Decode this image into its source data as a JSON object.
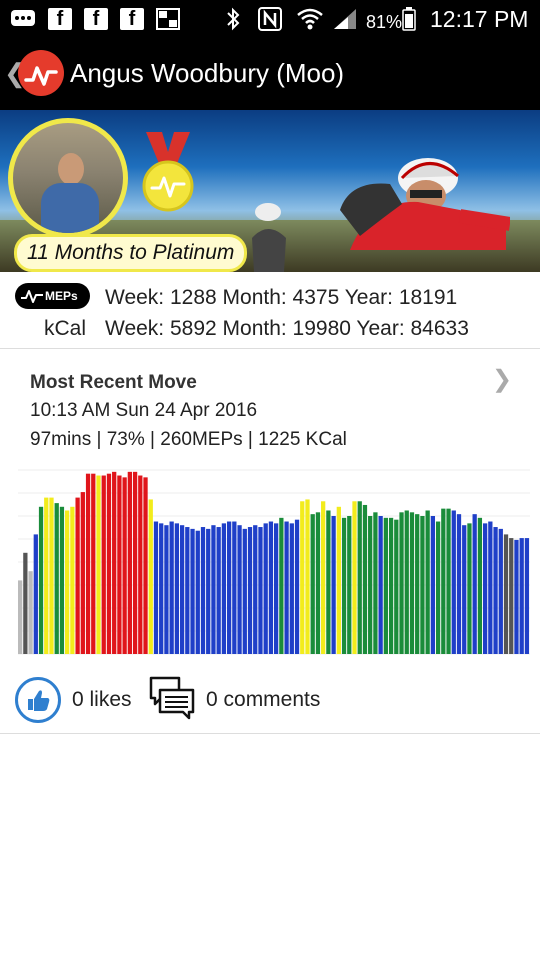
{
  "status_bar": {
    "notification_icons": [
      "message-icon",
      "facebook-icon",
      "facebook-icon",
      "facebook-icon",
      "gallery-icon"
    ],
    "system_icons": [
      "bluetooth-icon",
      "nfc-icon",
      "wifi-icon",
      "signal-icon"
    ],
    "battery": "81%",
    "time": "12:17 PM"
  },
  "app_bar": {
    "title": "Angus Woodbury (Moo)",
    "brand_color": "#e53b2c"
  },
  "banner": {
    "platinum_text": "11 Months to Platinum",
    "medal_color": "#f0e84a",
    "ribbon_color": "#d8322b"
  },
  "stats": {
    "meps_badge": "MEPs",
    "meps": "Week: 1288 Month: 4375 Year: 18191",
    "kcal_label": "kCal",
    "kcal": "Week: 5892 Month: 19980 Year: 84633"
  },
  "recent_move": {
    "title": "Most Recent Move",
    "datetime": "10:13 AM Sun 24 Apr 2016",
    "summary": "97mins | 73% | 260MEPs | 1225 KCal"
  },
  "chart_data": {
    "type": "bar",
    "ylim": [
      0,
      100
    ],
    "zone_colors": {
      "light_gray": "#bbbbbb",
      "gray": "#555555",
      "blue": "#1f3fc8",
      "green": "#1a8c3a",
      "yellow": "#f2ec1c",
      "red": "#e0151b"
    },
    "values": [
      40,
      55,
      45,
      65,
      80,
      85,
      85,
      82,
      80,
      78,
      80,
      85,
      88,
      98,
      98,
      97,
      97,
      98,
      99,
      97,
      96,
      99,
      99,
      97,
      96,
      84,
      72,
      71,
      70,
      72,
      71,
      70,
      69,
      68,
      67,
      69,
      68,
      70,
      69,
      71,
      72,
      72,
      70,
      68,
      69,
      70,
      69,
      71,
      72,
      71,
      74,
      72,
      71,
      73,
      83,
      84,
      76,
      77,
      83,
      78,
      75,
      80,
      74,
      75,
      83,
      83,
      81,
      75,
      77,
      75,
      74,
      74,
      73,
      77,
      78,
      77,
      76,
      75,
      78,
      75,
      72,
      79,
      79,
      78,
      76,
      70,
      71,
      76,
      74,
      71,
      72,
      69,
      68,
      65,
      63,
      62,
      63,
      63
    ],
    "zones": [
      "light_gray",
      "gray",
      "light_gray",
      "blue",
      "green",
      "yellow",
      "yellow",
      "green",
      "green",
      "yellow",
      "yellow",
      "red",
      "red",
      "red",
      "red",
      "yellow",
      "red",
      "red",
      "red",
      "red",
      "red",
      "red",
      "red",
      "red",
      "red",
      "yellow",
      "blue",
      "blue",
      "blue",
      "blue",
      "blue",
      "blue",
      "blue",
      "blue",
      "blue",
      "blue",
      "blue",
      "blue",
      "blue",
      "blue",
      "blue",
      "blue",
      "blue",
      "blue",
      "blue",
      "blue",
      "blue",
      "blue",
      "blue",
      "blue",
      "green",
      "blue",
      "blue",
      "blue",
      "yellow",
      "yellow",
      "green",
      "green",
      "yellow",
      "green",
      "blue",
      "yellow",
      "green",
      "green",
      "yellow",
      "green",
      "green",
      "green",
      "green",
      "blue",
      "green",
      "green",
      "green",
      "green",
      "green",
      "green",
      "green",
      "green",
      "green",
      "blue",
      "green",
      "green",
      "green",
      "blue",
      "blue",
      "blue",
      "green",
      "blue",
      "green",
      "blue",
      "blue",
      "blue",
      "blue",
      "gray",
      "gray",
      "blue",
      "blue",
      "blue"
    ]
  },
  "social": {
    "likes": "0 likes",
    "comments": "0 comments",
    "like_color": "#2f7fcf"
  }
}
